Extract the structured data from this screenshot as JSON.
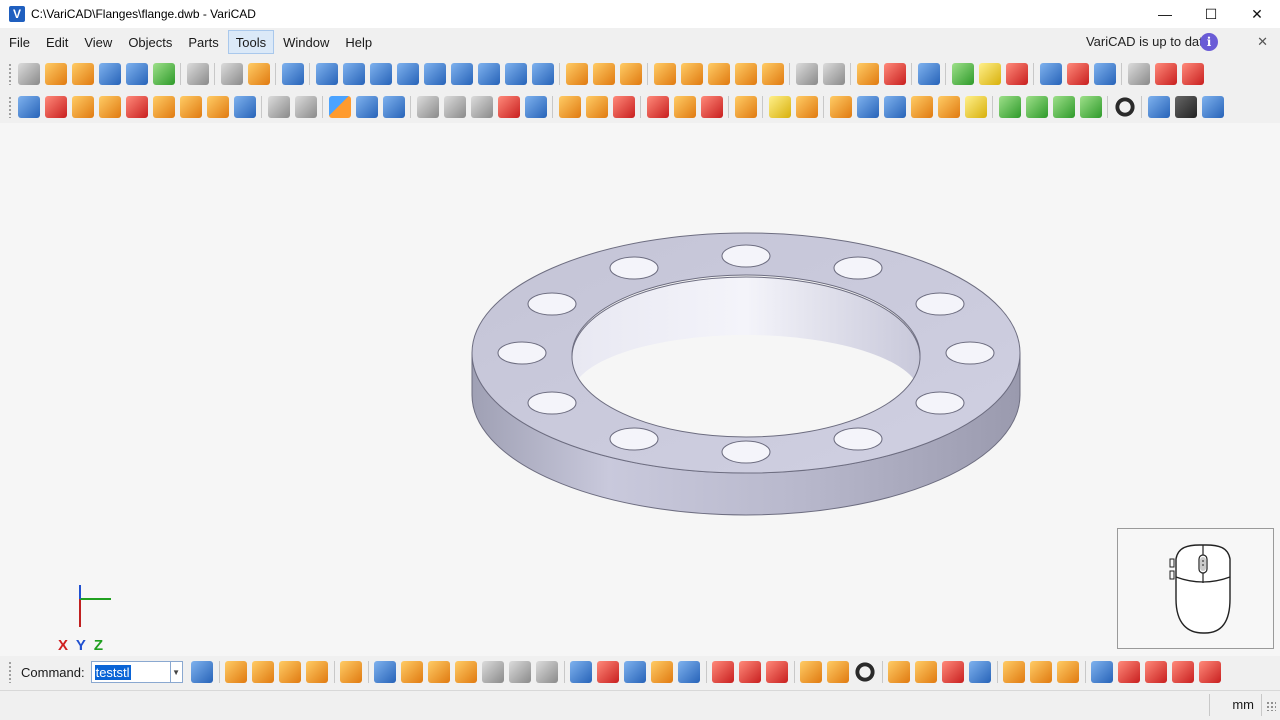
{
  "window": {
    "title": "C:\\VariCAD\\Flanges\\flange.dwb - VariCAD",
    "logo_letter": "V",
    "minimize": "—",
    "maximize": "☐",
    "close": "✕"
  },
  "menu": {
    "items": [
      {
        "label": "File"
      },
      {
        "label": "Edit"
      },
      {
        "label": "View"
      },
      {
        "label": "Objects"
      },
      {
        "label": "Parts"
      },
      {
        "label": "Tools",
        "active": true
      },
      {
        "label": "Window"
      },
      {
        "label": "Help"
      }
    ],
    "update_message": "VariCAD is up to date",
    "info_glyph": "i",
    "notice_close": "✕"
  },
  "viewport": {
    "axis_labels": {
      "x": "X",
      "y": "Y",
      "z": "Z"
    },
    "model": "flange",
    "bolt_hole_count": 12,
    "colors": {
      "face": "#c7c7db",
      "side": "#b4b4c8",
      "background": "#f6f6f6"
    }
  },
  "command": {
    "label": "Command:",
    "value": "teststl"
  },
  "status": {
    "unit": "mm"
  }
}
